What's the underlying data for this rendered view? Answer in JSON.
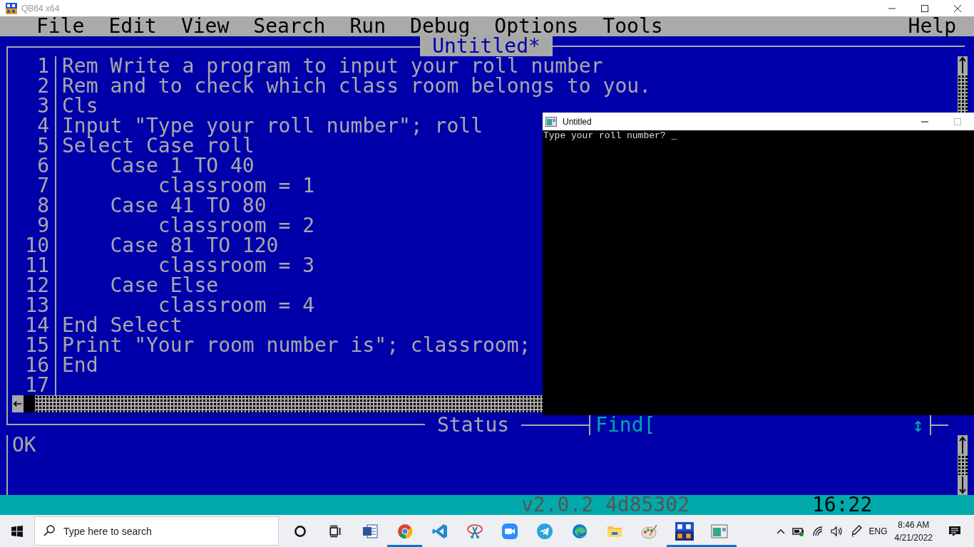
{
  "window": {
    "title": "QB64 x64"
  },
  "menu": [
    {
      "label": "File"
    },
    {
      "label": "Edit"
    },
    {
      "label": "View"
    },
    {
      "label": "Search"
    },
    {
      "label": "Run"
    },
    {
      "label": "Debug"
    },
    {
      "label": "Options"
    },
    {
      "label": "Tools"
    },
    {
      "label": "Help"
    }
  ],
  "editor": {
    "title": "Untitled*",
    "lines": [
      {
        "number": "1",
        "text": "Rem Write a program to input your roll number"
      },
      {
        "number": "2",
        "text": "Rem and to check which class room belongs to you."
      },
      {
        "number": "3",
        "text": "Cls"
      },
      {
        "number": "4",
        "text": "Input \"Type your roll number\"; roll"
      },
      {
        "number": "5",
        "text": "Select Case roll"
      },
      {
        "number": "6",
        "text": "    Case 1 TO 40"
      },
      {
        "number": "7",
        "text": "        classroom = 1"
      },
      {
        "number": "8",
        "text": "    Case 41 TO 80"
      },
      {
        "number": "9",
        "text": "        classroom = 2"
      },
      {
        "number": "10",
        "text": "    Case 81 TO 120"
      },
      {
        "number": "11",
        "text": "        classroom = 3"
      },
      {
        "number": "12",
        "text": "    Case Else"
      },
      {
        "number": "13",
        "text": "        classroom = 4"
      },
      {
        "number": "14",
        "text": "End Select"
      },
      {
        "number": "15",
        "text": "Print \"Your room number is\"; classroom;"
      },
      {
        "number": "16",
        "text": "End"
      },
      {
        "number": "17"
      }
    ]
  },
  "status": {
    "title": "Status",
    "find_label": "Find[",
    "find_arrow": "↕",
    "message": "OK"
  },
  "bottom_bar": {
    "version": "v2.0.2 4d85302",
    "position": "16:22"
  },
  "console": {
    "title": "Untitled",
    "output": "Type your roll number? _"
  },
  "taskbar": {
    "search_placeholder": "Type here to search",
    "apps": [
      {
        "kind": "cortana",
        "active": false
      },
      {
        "kind": "taskview",
        "active": false
      },
      {
        "kind": "word",
        "active": false
      },
      {
        "kind": "chrome",
        "active": true
      },
      {
        "kind": "vscode",
        "active": false
      },
      {
        "kind": "snip",
        "active": false
      },
      {
        "kind": "zoom",
        "active": false
      },
      {
        "kind": "telegram",
        "active": false
      },
      {
        "kind": "edge",
        "active": false
      },
      {
        "kind": "explorer",
        "active": false
      },
      {
        "kind": "paint",
        "active": false
      },
      {
        "kind": "qb64",
        "active": true
      },
      {
        "kind": "console",
        "active": true
      }
    ],
    "language": "ENG",
    "time": "8:46 AM",
    "date": "4/21/2022"
  }
}
